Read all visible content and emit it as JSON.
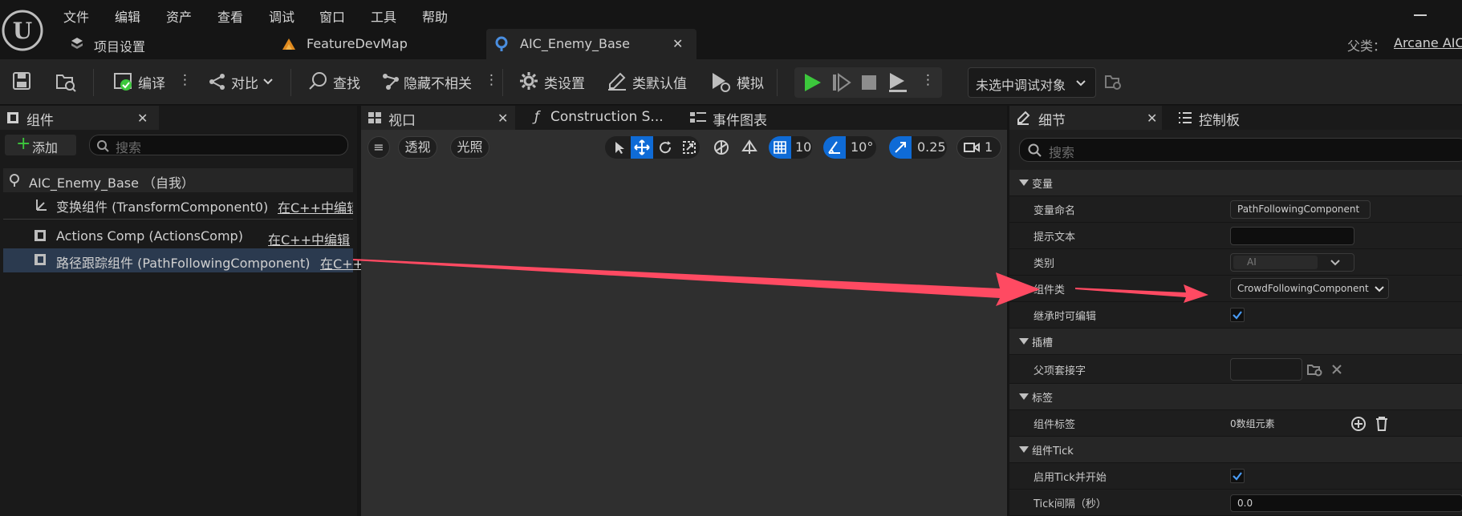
{
  "menu": [
    "文件",
    "编辑",
    "资产",
    "查看",
    "调试",
    "窗口",
    "工具",
    "帮助"
  ],
  "tabs": {
    "project_settings": "项目设置",
    "map": "FeatureDevMap",
    "asset": "AIC_Enemy_Base",
    "close_glyph": "✕"
  },
  "parent_class": {
    "label": "父类：",
    "value": "Arcane AIC"
  },
  "toolbar": {
    "compile": "编译",
    "diff": "对比",
    "find": "查找",
    "hide_unrelated": "隐藏不相关",
    "class_settings": "类设置",
    "class_defaults": "类默认值",
    "simulate": "模拟",
    "debug_target": "未选中调试对象"
  },
  "components_panel": {
    "title": "组件",
    "add_label": "添加",
    "search_placeholder": "搜索",
    "items": [
      {
        "label": "AIC_Enemy_Base （自我）",
        "edit": ""
      },
      {
        "label": "变换组件 (TransformComponent0)",
        "edit": "在C++中编辑"
      },
      {
        "label": "Actions Comp (ActionsComp)",
        "edit": "在C++中编辑"
      },
      {
        "label": "路径跟踪组件 (PathFollowingComponent)",
        "edit": "在C++"
      }
    ]
  },
  "viewport": {
    "tabs": [
      "视口",
      "Construction S...",
      "事件图表"
    ],
    "perspective": "透视",
    "lighting": "光照",
    "grid_snap": "10",
    "rotation_snap": "10°",
    "scale_snap": "0.25",
    "camera_speed": "1"
  },
  "details_panel": {
    "title": "细节",
    "second_tab": "控制板",
    "search_placeholder": "搜索",
    "categories": {
      "variable": "变量",
      "sockets": "插槽",
      "tags": "标签",
      "component_tick": "组件Tick"
    },
    "props": {
      "variable_name_label": "变量命名",
      "variable_name_value": "PathFollowingComponent",
      "tooltip_label": "提示文本",
      "category_label": "类别",
      "category_value": "AI",
      "component_class_label": "组件类",
      "component_class_value": "CrowdFollowingComponent",
      "editable_when_inherited_label": "继承时可编辑",
      "editable_when_inherited": true,
      "parent_socket_label": "父项套接字",
      "component_tags_label": "组件标签",
      "component_tags_value": "0数组元素",
      "start_with_tick_label": "启用Tick并开始",
      "start_with_tick": true,
      "tick_interval_label": "Tick间隔（秒）",
      "tick_interval_value": "0.0"
    }
  },
  "colors": {
    "accent_blue": "#0f6bd6",
    "play_green": "#3cc73c",
    "annotation_arrow": "#ff4a62"
  }
}
